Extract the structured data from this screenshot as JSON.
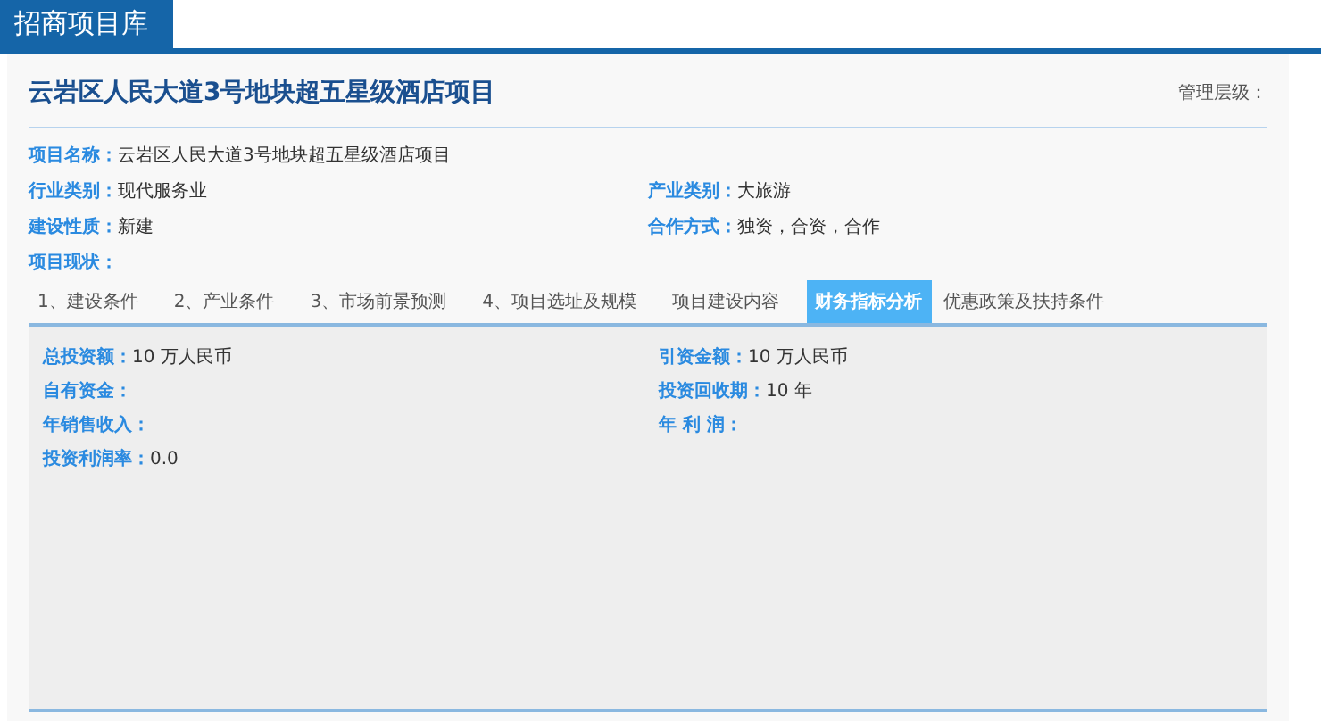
{
  "header": {
    "title": "招商项目库"
  },
  "project": {
    "title": "云岩区人民大道3号地块超五星级酒店项目",
    "level_label": "管理层级："
  },
  "info_rows": [
    [
      {
        "label": "项目名称：",
        "value": "云岩区人民大道3号地块超五星级酒店项目"
      }
    ],
    [
      {
        "label": "行业类别：",
        "value": "现代服务业"
      },
      {
        "label": "产业类别：",
        "value": "大旅游"
      }
    ],
    [
      {
        "label": "建设性质：",
        "value": "新建"
      },
      {
        "label": "合作方式：",
        "value": "独资，合资，合作"
      }
    ],
    [
      {
        "label": "项目现状："
      }
    ]
  ],
  "tabs": [
    {
      "label": "1、建设条件",
      "selected": false
    },
    {
      "label": "2、产业条件",
      "selected": false
    },
    {
      "label": "3、市场前景预测",
      "selected": false
    },
    {
      "label": "4、项目选址及规模",
      "selected": false
    },
    {
      "label": "项目建设内容",
      "selected": false
    },
    {
      "label": "财务指标分析",
      "selected": true
    },
    {
      "label": "优惠政策及扶持条件",
      "selected": false
    }
  ],
  "finance_rows": [
    [
      {
        "label": "总投资额：",
        "value": "10 万人民币"
      },
      {
        "label": "引资金额：",
        "value": "10 万人民币"
      }
    ],
    [
      {
        "label": "自有资金："
      },
      {
        "label": "投资回收期：",
        "value": "10 年"
      }
    ],
    [
      {
        "label": "年销售收入："
      },
      {
        "label": "年 利 润："
      }
    ],
    [
      {
        "label": "投资利润率：",
        "value": "0.0"
      }
    ]
  ]
}
